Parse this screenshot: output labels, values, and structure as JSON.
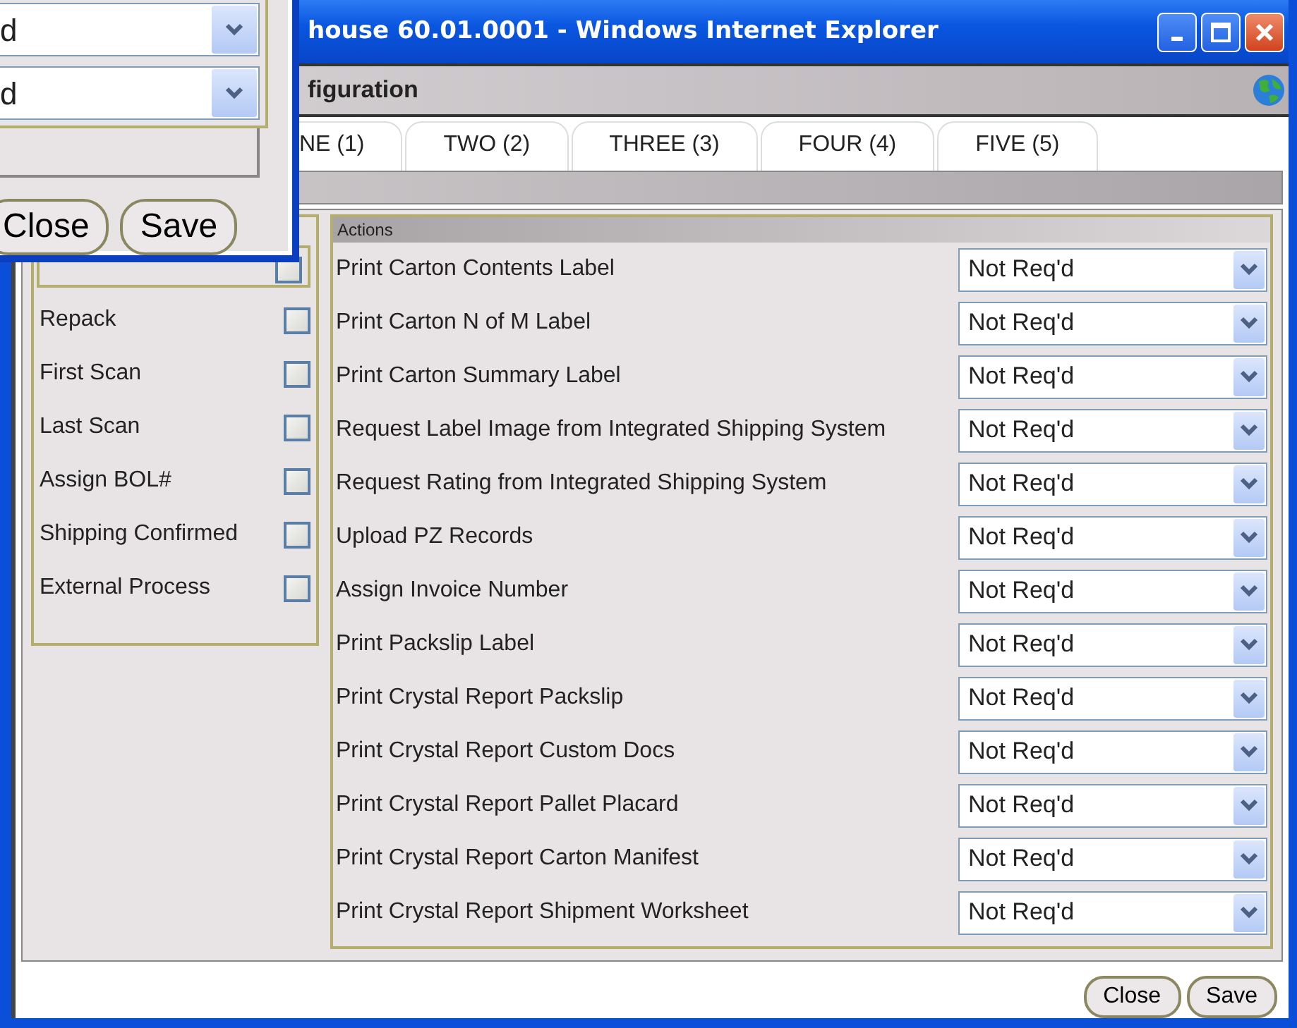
{
  "window": {
    "title": "house 60.01.0001 - Windows Internet Explorer"
  },
  "header": {
    "title": "figuration"
  },
  "tabs": [
    {
      "label": "NE (1)"
    },
    {
      "label": "TWO (2)"
    },
    {
      "label": "THREE (3)"
    },
    {
      "label": "FOUR (4)"
    },
    {
      "label": "FIVE (5)"
    }
  ],
  "top_option": {
    "checked": false
  },
  "options": [
    {
      "label": "Repack",
      "checked": false
    },
    {
      "label": "First Scan",
      "checked": false
    },
    {
      "label": "Last Scan",
      "checked": false
    },
    {
      "label": "Assign BOL#",
      "checked": false
    },
    {
      "label": "Shipping Confirmed",
      "checked": false
    },
    {
      "label": "External Process",
      "checked": false
    }
  ],
  "actions": {
    "title": "Actions",
    "rows": [
      {
        "label": "Print Carton Contents Label",
        "value": "Not Req'd"
      },
      {
        "label": "Print Carton N of M Label",
        "value": "Not Req'd"
      },
      {
        "label": "Print Carton Summary Label",
        "value": "Not Req'd"
      },
      {
        "label": "Request Label Image from Integrated Shipping System",
        "value": "Not Req'd"
      },
      {
        "label": "Request Rating from Integrated Shipping System",
        "value": "Not Req'd"
      },
      {
        "label": "Upload PZ Records",
        "value": "Not Req'd"
      },
      {
        "label": "Assign Invoice Number",
        "value": "Not Req'd"
      },
      {
        "label": "Print Packslip Label",
        "value": "Not Req'd"
      },
      {
        "label": "Print Crystal Report Packslip",
        "value": "Not Req'd"
      },
      {
        "label": "Print Crystal Report Custom Docs",
        "value": "Not Req'd"
      },
      {
        "label": "Print Crystal Report Pallet Placard",
        "value": "Not Req'd"
      },
      {
        "label": "Print Crystal Report Carton Manifest",
        "value": "Not Req'd"
      },
      {
        "label": "Print Crystal Report Shipment Worksheet",
        "value": "Not Req'd"
      }
    ]
  },
  "buttons": [
    "Close",
    "Save"
  ],
  "dialog": {
    "selects": [
      {
        "value": "d"
      },
      {
        "value": "d"
      }
    ],
    "buttons": [
      "Close",
      "Save"
    ]
  }
}
